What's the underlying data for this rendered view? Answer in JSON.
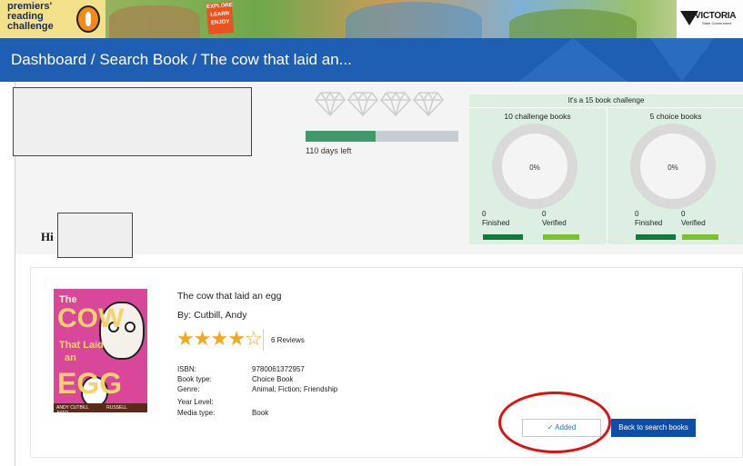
{
  "banner": {
    "logo_line1": "premiers'",
    "logo_line2": "reading",
    "logo_line3": "challenge",
    "explore_words": [
      "EXPLORE",
      "LEARN",
      "ENJOY"
    ],
    "gov_name": "VICTORIA",
    "gov_sub": "State Government"
  },
  "breadcrumb": {
    "text": "Dashboard / Search Book / The cow that laid an..."
  },
  "student": {
    "greeting": "Hi"
  },
  "progress": {
    "diamond_count": 4,
    "fraction_complete": 0.46,
    "days_left": "110 days left",
    "fill_color": "#3f9a67"
  },
  "challenge": {
    "title": "It's a 15 book challenge",
    "columns": [
      {
        "heading": "10 challenge books",
        "percent": "0%",
        "finished_count": "0",
        "finished_label": "Finished",
        "verified_count": "0",
        "verified_label": "Verified"
      },
      {
        "heading": "5 choice books",
        "percent": "0%",
        "finished_count": "0",
        "finished_label": "Finished",
        "verified_count": "0",
        "verified_label": "Verified"
      }
    ],
    "finished_color": "#117a3d",
    "verified_color": "#7cc22a"
  },
  "book": {
    "title": "The cow that laid an egg",
    "author": "By:  Cutbill, Andy",
    "rating": 4,
    "max_rating": 5,
    "reviews": "6 Reviews",
    "cover": {
      "line1": "The",
      "line2": "COW",
      "line3": "That Laid",
      "line4": "an",
      "line5": "EGG",
      "author1": "ANDY CUTBILL",
      "author2": "RUSSELL AYTO"
    },
    "details": [
      {
        "label": "ISBN:",
        "value": "9780061372957"
      },
      {
        "label": "Book type:",
        "value": "Choice Book"
      },
      {
        "label": "Genre:",
        "value": "Animal; Fiction; Friendship"
      },
      {
        "label": "Year Level:",
        "value": ""
      },
      {
        "label": "Media type:",
        "value": "Book"
      }
    ]
  },
  "actions": {
    "added_label": "✓ Added",
    "back_label": "Back to search books"
  }
}
